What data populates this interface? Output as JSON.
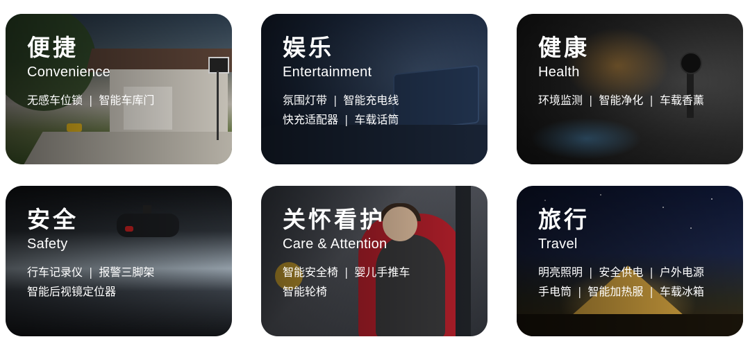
{
  "cards": [
    {
      "title": "便捷",
      "subtitle": "Convenience",
      "lines": [
        [
          "无感车位锁",
          "智能车库门"
        ]
      ]
    },
    {
      "title": "娱乐",
      "subtitle": "Entertainment",
      "lines": [
        [
          "氛围灯带",
          "智能充电线"
        ],
        [
          "快充适配器",
          "车载话筒"
        ]
      ]
    },
    {
      "title": "健康",
      "subtitle": "Health",
      "lines": [
        [
          "环境监测",
          "智能净化",
          "车载香薰"
        ]
      ]
    },
    {
      "title": "安全",
      "subtitle": "Safety",
      "lines": [
        [
          "行车记录仪",
          "报警三脚架"
        ],
        [
          "智能后视镜定位器"
        ]
      ]
    },
    {
      "title": "关怀看护",
      "subtitle": "Care & Attention",
      "lines": [
        [
          "智能安全椅",
          "婴儿手推车"
        ],
        [
          "智能轮椅"
        ]
      ]
    },
    {
      "title": "旅行",
      "subtitle": "Travel",
      "lines": [
        [
          "明亮照明",
          "安全供电",
          "户外电源"
        ],
        [
          "手电筒",
          "智能加热服",
          "车载冰箱"
        ]
      ]
    }
  ],
  "separator": "|"
}
